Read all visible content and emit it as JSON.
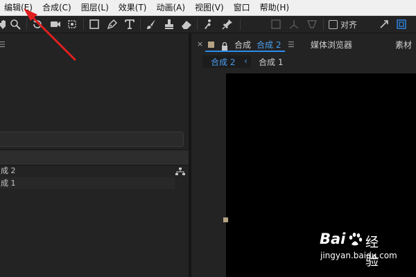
{
  "menubar": {
    "items": [
      "编辑(E)",
      "合成(C)",
      "图层(L)",
      "效果(T)",
      "动画(A)",
      "视图(V)",
      "窗口",
      "帮助(H)"
    ]
  },
  "toolbar": {
    "tools": [
      "hand-icon",
      "zoom-icon",
      "rotate-icon",
      "camera-icon",
      "pan-behind-icon",
      "rectangle-icon",
      "pen-icon",
      "text-icon",
      "brush-icon",
      "clone-stamp-icon",
      "eraser-icon",
      "roto-brush-icon",
      "puppet-pin-icon"
    ],
    "snap_label": "对齐"
  },
  "viewer_panel": {
    "panel_label": "合成",
    "active_tab": "合成 2",
    "other_tabs": [
      "媒体浏览器",
      "素材"
    ],
    "breadcrumb": [
      "合成 2",
      "合成 1"
    ],
    "accent_color": "#2d8ceb",
    "swatch_color": "#b6a383"
  },
  "project_panel": {
    "items": [
      "成 2",
      "成 1"
    ]
  },
  "watermark": {
    "brand": "Bai",
    "brand_suffix": "经验",
    "url": "jingyan.baidu.com"
  }
}
